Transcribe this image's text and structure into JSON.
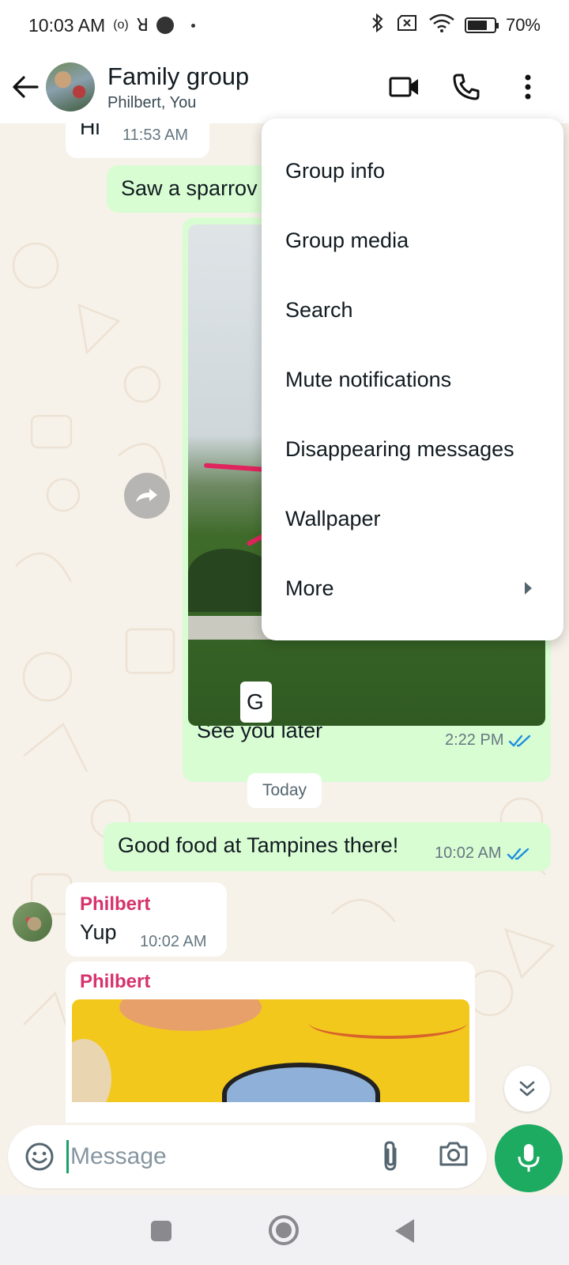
{
  "status_bar": {
    "time": "10:03 AM",
    "indicators": [
      "(o)",
      "ꓤ"
    ],
    "battery": "70%",
    "icons": [
      "bluetooth-icon",
      "sim-off-icon",
      "wifi-icon",
      "battery-icon"
    ]
  },
  "header": {
    "title": "Family group",
    "subtitle": "Philbert, You",
    "icons": [
      "back-arrow-icon",
      "group-avatar",
      "video-call-icon",
      "voice-call-icon",
      "more-vert-icon"
    ]
  },
  "messages": [
    {
      "direction": "in",
      "text": "Hi",
      "time": "11:53 AM"
    },
    {
      "direction": "out",
      "text": "Saw a sparrov"
    },
    {
      "direction": "out",
      "caption": "See you later",
      "time": "2:22 PM",
      "image_tag": "G",
      "ticks": "read"
    },
    {
      "date_chip": "Today"
    },
    {
      "direction": "out",
      "text": "Good food at Tampines there!",
      "time": "10:02 AM",
      "ticks": "read"
    },
    {
      "direction": "in",
      "sender": "Philbert",
      "text": "Yup",
      "time": "10:02 AM"
    },
    {
      "direction": "in",
      "sender": "Philbert",
      "type": "image"
    }
  ],
  "menu": {
    "items": [
      {
        "label": "Group info"
      },
      {
        "label": "Group media"
      },
      {
        "label": "Search"
      },
      {
        "label": "Mute notifications"
      },
      {
        "label": "Disappearing messages"
      },
      {
        "label": "Wallpaper"
      },
      {
        "label": "More",
        "has_submenu": true
      }
    ]
  },
  "input": {
    "placeholder": "Message",
    "icons": [
      "emoji-icon",
      "attach-icon",
      "camera-icon",
      "mic-icon"
    ]
  },
  "colors": {
    "chat_background": "#f6f1e9",
    "outgoing_bubble": "#d9fdd3",
    "incoming_bubble": "#ffffff",
    "sender_name": "#d6336c",
    "accent_green": "#1daa61",
    "read_tick": "#1d8fe0"
  }
}
